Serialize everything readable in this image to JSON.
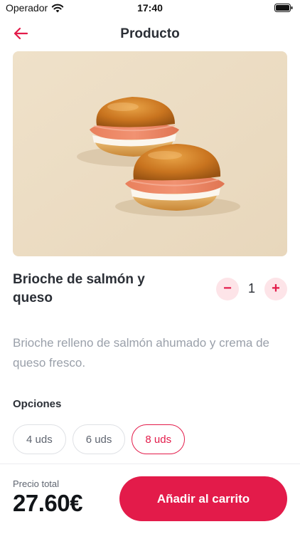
{
  "status_bar": {
    "carrier": "Operador",
    "time": "17:40",
    "icons": [
      "wifi-icon",
      "battery-icon"
    ]
  },
  "nav": {
    "title": "Producto",
    "back_icon": "arrow-left-icon"
  },
  "product": {
    "image": "salmon-brioche-photo",
    "name": "Brioche de salmón y queso",
    "description": "Brioche relleno de salmón ahumado y crema de queso fresco.",
    "quantity": "1",
    "decrement_label": "−",
    "increment_label": "+"
  },
  "options": {
    "title": "Opciones",
    "items": [
      {
        "label": "4 uds",
        "selected": false
      },
      {
        "label": "6 uds",
        "selected": false
      },
      {
        "label": "8 uds",
        "selected": true
      }
    ]
  },
  "footer": {
    "total_label": "Precio total",
    "total_value": "27.60€",
    "add_button_label": "Añadir al carrito"
  },
  "colors": {
    "accent": "#e31b4a",
    "accent_soft": "#fde4e8",
    "text_dark": "#2b2f36",
    "text_muted": "#9aa0aa"
  }
}
